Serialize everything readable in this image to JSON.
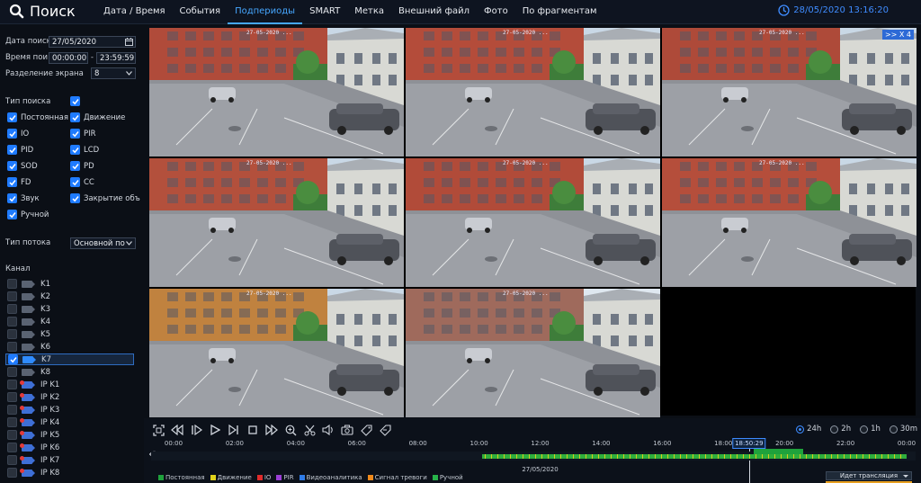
{
  "header": {
    "title": "Поиск",
    "tabs": [
      "Дата / Время",
      "События",
      "Подпериоды",
      "SMART",
      "Метка",
      "Внешний файл",
      "Фото",
      "По фрагментам"
    ],
    "active_tab": 2,
    "datetime": "28/05/2020 13:16:20"
  },
  "left": {
    "date_label": "Дата поиск",
    "date_value": "27/05/2020",
    "time_label": "Время пои",
    "time_from": "00:00:00",
    "time_sep": "-",
    "time_to": "23:59:59",
    "split_label": "Разделение экрана",
    "split_value": "8",
    "search_type_label": "Тип поиска",
    "types": [
      {
        "label": "Постоянная",
        "checked": true
      },
      {
        "label": "Движение",
        "checked": true
      },
      {
        "label": "IO",
        "checked": true
      },
      {
        "label": "PIR",
        "checked": true
      },
      {
        "label": "PID",
        "checked": true
      },
      {
        "label": "LCD",
        "checked": true
      },
      {
        "label": "SOD",
        "checked": true
      },
      {
        "label": "PD",
        "checked": true
      },
      {
        "label": "FD",
        "checked": true
      },
      {
        "label": "CC",
        "checked": true
      },
      {
        "label": "Звук",
        "checked": true
      },
      {
        "label": "Закрытие объ",
        "checked": true
      },
      {
        "label": "Ручной",
        "checked": true
      }
    ],
    "stream_label": "Тип потока",
    "stream_value": "Основной по",
    "channel_label": "Канал",
    "channels": [
      {
        "label": "K1",
        "checked": false,
        "ip": false
      },
      {
        "label": "K2",
        "checked": false,
        "ip": false
      },
      {
        "label": "K3",
        "checked": false,
        "ip": false
      },
      {
        "label": "K4",
        "checked": false,
        "ip": false
      },
      {
        "label": "K5",
        "checked": false,
        "ip": false
      },
      {
        "label": "K6",
        "checked": false,
        "ip": false
      },
      {
        "label": "K7",
        "checked": true,
        "ip": false
      },
      {
        "label": "K8",
        "checked": false,
        "ip": false
      },
      {
        "label": "IP K1",
        "checked": false,
        "ip": true
      },
      {
        "label": "IP K2",
        "checked": false,
        "ip": true
      },
      {
        "label": "IP K3",
        "checked": false,
        "ip": true
      },
      {
        "label": "IP K4",
        "checked": false,
        "ip": true
      },
      {
        "label": "IP K5",
        "checked": false,
        "ip": true
      },
      {
        "label": "IP K6",
        "checked": false,
        "ip": true
      },
      {
        "label": "IP K7",
        "checked": false,
        "ip": true
      },
      {
        "label": "IP K8",
        "checked": false,
        "ip": true
      }
    ]
  },
  "grid": {
    "cell_timestamp": "27-05-2020 ...",
    "speed_badge": ">> X 4"
  },
  "timeline": {
    "zoom_options": [
      "24h",
      "2h",
      "1h",
      "30m"
    ],
    "zoom_selected": 0,
    "ticks": [
      "00:00",
      "02:00",
      "04:00",
      "06:00",
      "08:00",
      "10:00",
      "12:00",
      "14:00",
      "16:00",
      "18:00",
      "20:00",
      "22:00",
      "00:00"
    ],
    "cursor_time": "18:50:29",
    "date": "27/05/2020",
    "recording_start_hour": 10.1,
    "recording_end_hour": 24,
    "alarm_start_hour": 19.0,
    "alarm_end_hour": 20.6,
    "legend": [
      {
        "label": "Постоянная",
        "color": "#1fa23c"
      },
      {
        "label": "Движение",
        "color": "#e1d21b"
      },
      {
        "label": "IO",
        "color": "#e02b2b"
      },
      {
        "label": "PIR",
        "color": "#9b3fd6"
      },
      {
        "label": "Видеоаналитика",
        "color": "#2f7be6"
      },
      {
        "label": "Сигнал тревоги",
        "color": "#f08a1c"
      },
      {
        "label": "Ручной",
        "color": "#27b34a"
      }
    ],
    "broadcast": "Идет трансляция"
  },
  "colors": {
    "accent": "#3d8bff",
    "checkbox": "#1f7bff"
  }
}
